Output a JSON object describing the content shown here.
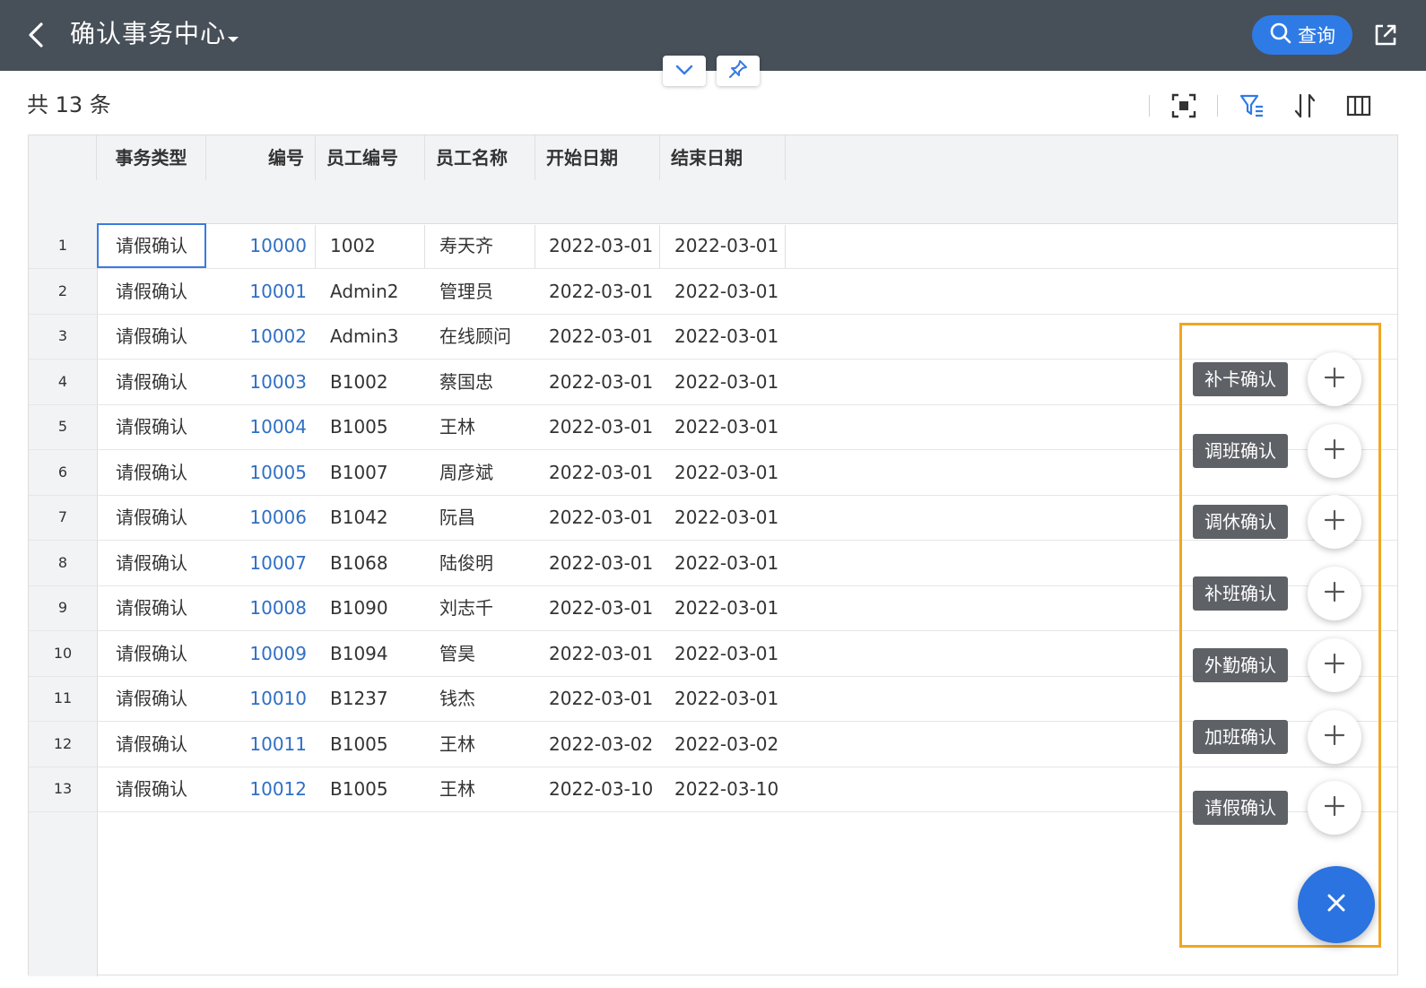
{
  "header": {
    "title": "确认事务中心",
    "query_label": "查询"
  },
  "toolbar": {
    "count_text": "共 13 条"
  },
  "grid": {
    "columns": [
      "事务类型",
      "编号",
      "员工编号",
      "员工名称",
      "开始日期",
      "结束日期"
    ],
    "rows": [
      {
        "num": "1",
        "type": "请假确认",
        "id": "10000",
        "emp": "1002",
        "name": "寿天齐",
        "start": "2022-03-01",
        "end": "2022-03-01"
      },
      {
        "num": "2",
        "type": "请假确认",
        "id": "10001",
        "emp": "Admin2",
        "name": "管理员",
        "start": "2022-03-01",
        "end": "2022-03-01"
      },
      {
        "num": "3",
        "type": "请假确认",
        "id": "10002",
        "emp": "Admin3",
        "name": "在线顾问",
        "start": "2022-03-01",
        "end": "2022-03-01"
      },
      {
        "num": "4",
        "type": "请假确认",
        "id": "10003",
        "emp": "B1002",
        "name": "蔡国忠",
        "start": "2022-03-01",
        "end": "2022-03-01"
      },
      {
        "num": "5",
        "type": "请假确认",
        "id": "10004",
        "emp": "B1005",
        "name": "王林",
        "start": "2022-03-01",
        "end": "2022-03-01"
      },
      {
        "num": "6",
        "type": "请假确认",
        "id": "10005",
        "emp": "B1007",
        "name": "周彦斌",
        "start": "2022-03-01",
        "end": "2022-03-01"
      },
      {
        "num": "7",
        "type": "请假确认",
        "id": "10006",
        "emp": "B1042",
        "name": "阮昌",
        "start": "2022-03-01",
        "end": "2022-03-01"
      },
      {
        "num": "8",
        "type": "请假确认",
        "id": "10007",
        "emp": "B1068",
        "name": "陆俊明",
        "start": "2022-03-01",
        "end": "2022-03-01"
      },
      {
        "num": "9",
        "type": "请假确认",
        "id": "10008",
        "emp": "B1090",
        "name": "刘志千",
        "start": "2022-03-01",
        "end": "2022-03-01"
      },
      {
        "num": "10",
        "type": "请假确认",
        "id": "10009",
        "emp": "B1094",
        "name": "管昊",
        "start": "2022-03-01",
        "end": "2022-03-01"
      },
      {
        "num": "11",
        "type": "请假确认",
        "id": "10010",
        "emp": "B1237",
        "name": "钱杰",
        "start": "2022-03-01",
        "end": "2022-03-01"
      },
      {
        "num": "12",
        "type": "请假确认",
        "id": "10011",
        "emp": "B1005",
        "name": "王林",
        "start": "2022-03-02",
        "end": "2022-03-02"
      },
      {
        "num": "13",
        "type": "请假确认",
        "id": "10012",
        "emp": "B1005",
        "name": "王林",
        "start": "2022-03-10",
        "end": "2022-03-10"
      }
    ]
  },
  "fab_menu": {
    "items": [
      "补卡确认",
      "调班确认",
      "调休确认",
      "补班确认",
      "外勤确认",
      "加班确认",
      "请假确认"
    ]
  },
  "colors": {
    "header_bg": "#474f58",
    "accent": "#2f7be5",
    "link": "#2f6fc4",
    "highlight_frame": "#f0a623"
  },
  "icons": [
    "back-icon",
    "caret-down-icon",
    "search-icon",
    "share-icon",
    "chevron-down-icon",
    "pin-icon",
    "fullscreen-icon",
    "filter-icon",
    "sort-icon",
    "columns-icon",
    "plus-icon",
    "close-icon"
  ]
}
